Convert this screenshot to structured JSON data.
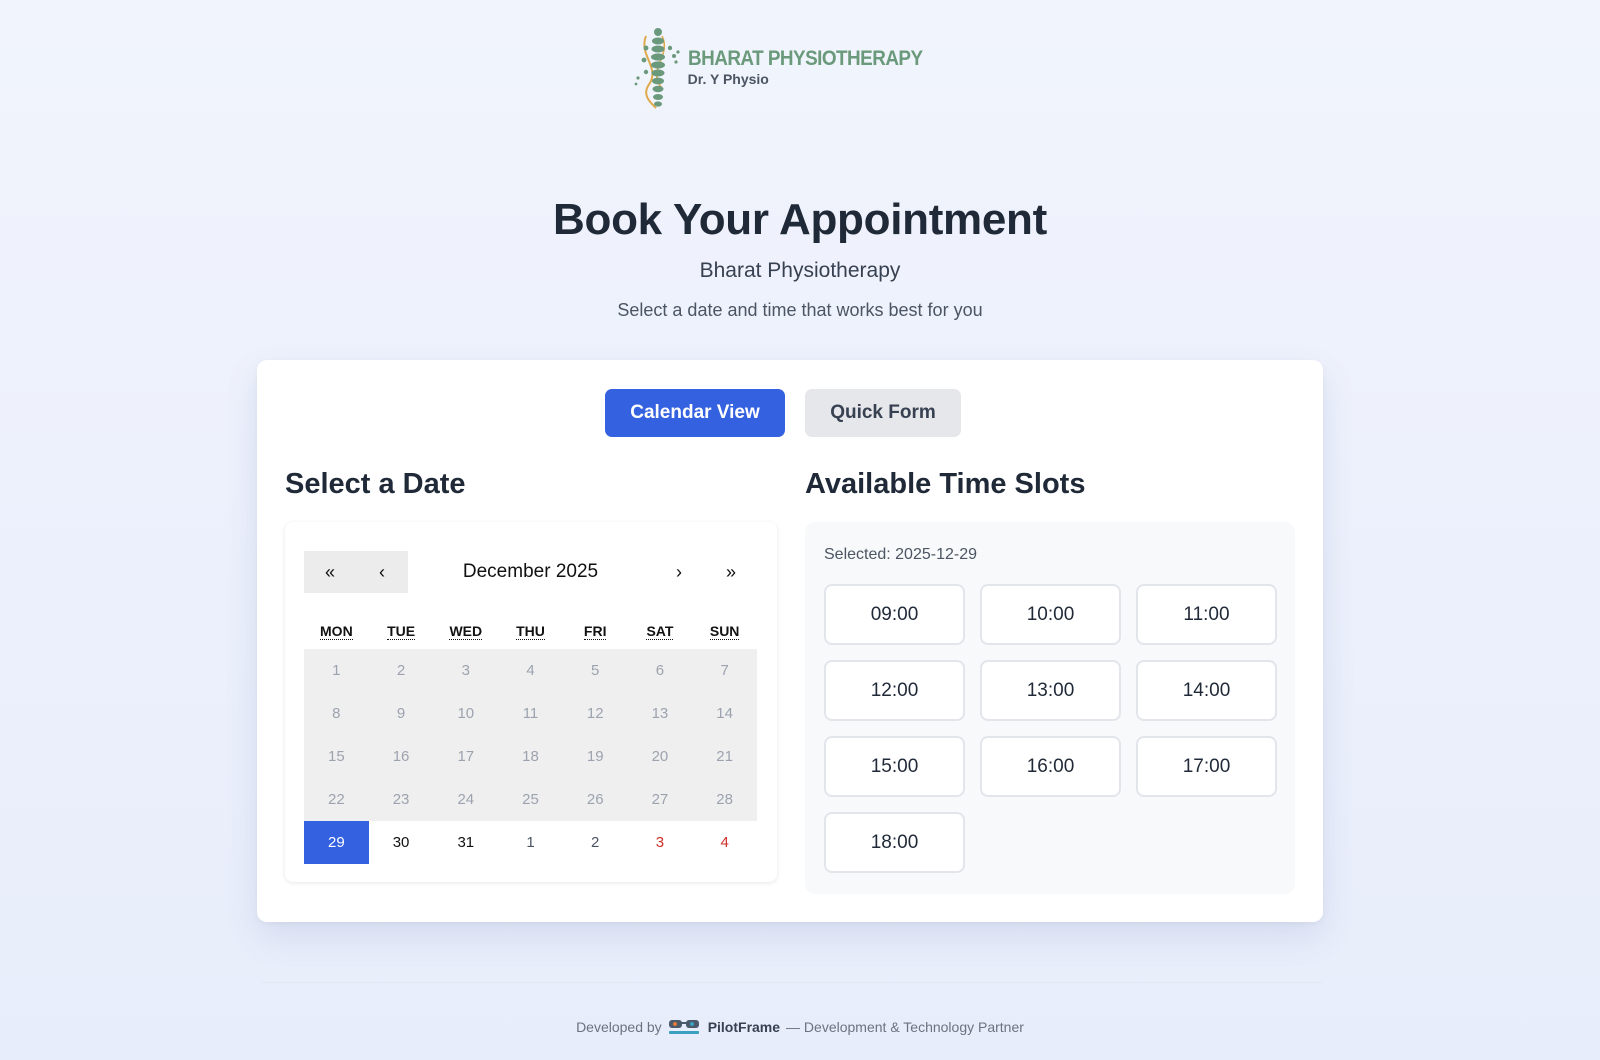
{
  "brand": {
    "name": "BHARAT PHYSIOTHERAPY",
    "subtitle": "Dr. Y Physio"
  },
  "hero": {
    "title": "Book Your Appointment",
    "subtitle": "Bharat Physiotherapy",
    "description": "Select a date and time that works best for you"
  },
  "view_toggle": {
    "calendar_label": "Calendar View",
    "quick_label": "Quick Form"
  },
  "date_section": {
    "title": "Select a Date"
  },
  "calendar": {
    "nav": {
      "prev_year": "«",
      "prev_month": "‹",
      "month_label": "December 2025",
      "next_month": "›",
      "next_year": "»"
    },
    "weekdays": [
      "MON",
      "TUE",
      "WED",
      "THU",
      "FRI",
      "SAT",
      "SUN"
    ],
    "days": [
      {
        "label": "1",
        "state": "past"
      },
      {
        "label": "2",
        "state": "past"
      },
      {
        "label": "3",
        "state": "past"
      },
      {
        "label": "4",
        "state": "past"
      },
      {
        "label": "5",
        "state": "past"
      },
      {
        "label": "6",
        "state": "past"
      },
      {
        "label": "7",
        "state": "past"
      },
      {
        "label": "8",
        "state": "past"
      },
      {
        "label": "9",
        "state": "past"
      },
      {
        "label": "10",
        "state": "past"
      },
      {
        "label": "11",
        "state": "past"
      },
      {
        "label": "12",
        "state": "past"
      },
      {
        "label": "13",
        "state": "past"
      },
      {
        "label": "14",
        "state": "past"
      },
      {
        "label": "15",
        "state": "past"
      },
      {
        "label": "16",
        "state": "past"
      },
      {
        "label": "17",
        "state": "past"
      },
      {
        "label": "18",
        "state": "past"
      },
      {
        "label": "19",
        "state": "past"
      },
      {
        "label": "20",
        "state": "past"
      },
      {
        "label": "21",
        "state": "past"
      },
      {
        "label": "22",
        "state": "past"
      },
      {
        "label": "23",
        "state": "past"
      },
      {
        "label": "24",
        "state": "past"
      },
      {
        "label": "25",
        "state": "past"
      },
      {
        "label": "26",
        "state": "past"
      },
      {
        "label": "27",
        "state": "past"
      },
      {
        "label": "28",
        "state": "past"
      },
      {
        "label": "29",
        "state": "selected"
      },
      {
        "label": "30",
        "state": "active"
      },
      {
        "label": "31",
        "state": "active"
      },
      {
        "label": "1",
        "state": "neighbor"
      },
      {
        "label": "2",
        "state": "neighbor"
      },
      {
        "label": "3",
        "state": "weekend"
      },
      {
        "label": "4",
        "state": "weekend"
      }
    ]
  },
  "slots_section": {
    "title": "Available Time Slots",
    "selected_text": "Selected: 2025-12-29",
    "slots": [
      "09:00",
      "10:00",
      "11:00",
      "12:00",
      "13:00",
      "14:00",
      "15:00",
      "16:00",
      "17:00",
      "18:00"
    ]
  },
  "footer": {
    "prefix": "Developed by",
    "brand": "PilotFrame",
    "suffix": "— Development & Technology Partner"
  },
  "colors": {
    "primary": "#3461e0",
    "brand_green": "#6a9a7b",
    "weekend_red": "#d0302a"
  }
}
